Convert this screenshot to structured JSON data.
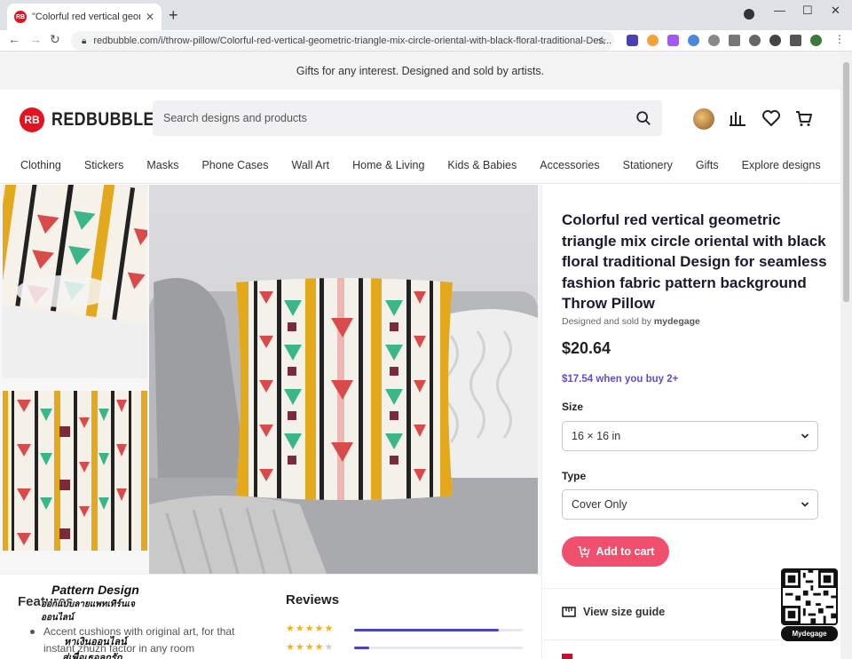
{
  "browser": {
    "tab_title": "\"Colorful red vertical geometric tr",
    "url": "redbubble.com/i/throw-pillow/Colorful-red-vertical-geometric-triangle-mix-circle-oriental-with-black-floral-traditional-Des..."
  },
  "banner": {
    "text": "Gifts for any interest. Designed and sold by artists."
  },
  "header": {
    "logo_text": "REDBUBBLE",
    "search_placeholder": "Search designs and products"
  },
  "categories": [
    "Clothing",
    "Stickers",
    "Masks",
    "Phone Cases",
    "Wall Art",
    "Home & Living",
    "Kids & Babies",
    "Accessories",
    "Stationery",
    "Gifts",
    "Explore designs"
  ],
  "product": {
    "title": "Colorful red vertical geometric triangle mix circle oriental with black floral traditional Design for seamless fashion fabric pattern background Throw Pillow",
    "seller_prefix": "Designed and sold by",
    "seller": "mydegage",
    "price": "$20.64",
    "bulk_price": "$17.54 when you buy 2+",
    "size_label": "Size",
    "size_value": "16 × 16 in",
    "type_label": "Type",
    "type_value": "Cover Only",
    "add_to_cart": "Add to cart",
    "size_guide": "View size guide"
  },
  "features": {
    "title": "Features",
    "item": "Accent cushions with original art, for that instant zhuzh factor in any room"
  },
  "reviews": {
    "title": "Reviews",
    "rows": [
      {
        "stars": 5,
        "fraction": 0.86
      },
      {
        "stars": 4,
        "fraction": 0.09
      }
    ]
  },
  "watermark": {
    "line1": "Pattern Design",
    "line2": "ออกแบบลายแพทเทิร์นเจออนไลน์",
    "line3": "หาเงินออนไลน์",
    "line4": "สู่เพื่อเธอลูกรัก",
    "qr_label": "Mydegage"
  },
  "colors": {
    "brand": "#e41321",
    "accent": "#5d4fd1",
    "cart": "#f0506e"
  }
}
